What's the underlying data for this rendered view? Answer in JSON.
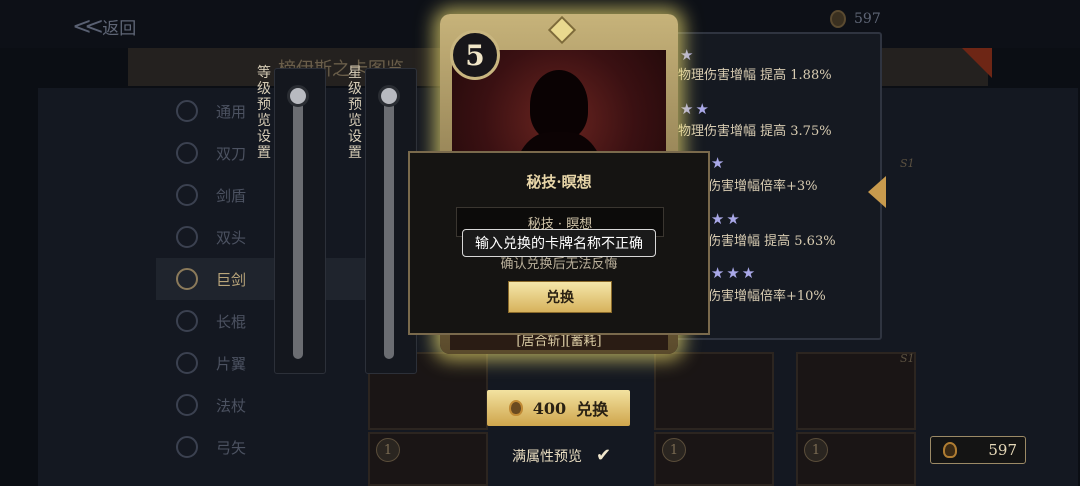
{
  "topbar": {
    "back_label": "返回",
    "currency_value": "597"
  },
  "page_title": "榜伊斯之卡图览",
  "categories": [
    {
      "label": "通用"
    },
    {
      "label": "双刀"
    },
    {
      "label": "剑盾"
    },
    {
      "label": "双头"
    },
    {
      "label": "巨剑"
    },
    {
      "label": "长棍"
    },
    {
      "label": "片翼"
    },
    {
      "label": "法杖"
    },
    {
      "label": "弓矢"
    }
  ],
  "sliders": {
    "level_label": "等级预览设置",
    "star_label": "星级预览设置",
    "level_value": 0,
    "star_value": 0
  },
  "card": {
    "cost": "5",
    "tags": "[居合斩][蓄耗]"
  },
  "effects": [
    {
      "stars": 1,
      "text": "物理伤害增幅 提高 1.88%"
    },
    {
      "stars": 2,
      "text": "物理伤害增幅 提高 3.75%"
    },
    {
      "stars": 3,
      "text": "伤害增幅倍率+3%"
    },
    {
      "stars": 4,
      "text": "伤害增幅 提高 5.63%"
    },
    {
      "stars": 5,
      "text": "伤害增幅倍率+10%"
    }
  ],
  "bg_cards": {
    "num": "1"
  },
  "side_label": "S1",
  "exchange_button": {
    "cost": "400",
    "label": "兑换"
  },
  "full_attr_preview": {
    "label": "满属性预览",
    "checked": true,
    "check_glyph": "✔"
  },
  "currency": {
    "value": "597"
  },
  "modal": {
    "title": "秘技·瞑想",
    "input_value": "秘技 · 瞑想",
    "warning": "确认兑换后无法反悔",
    "confirm_label": "兑换"
  },
  "toast": {
    "message": "输入兑换的卡牌名称不正确"
  },
  "colors": {
    "accent_gold": "#d7b25c",
    "star": "#a9a8e8"
  }
}
